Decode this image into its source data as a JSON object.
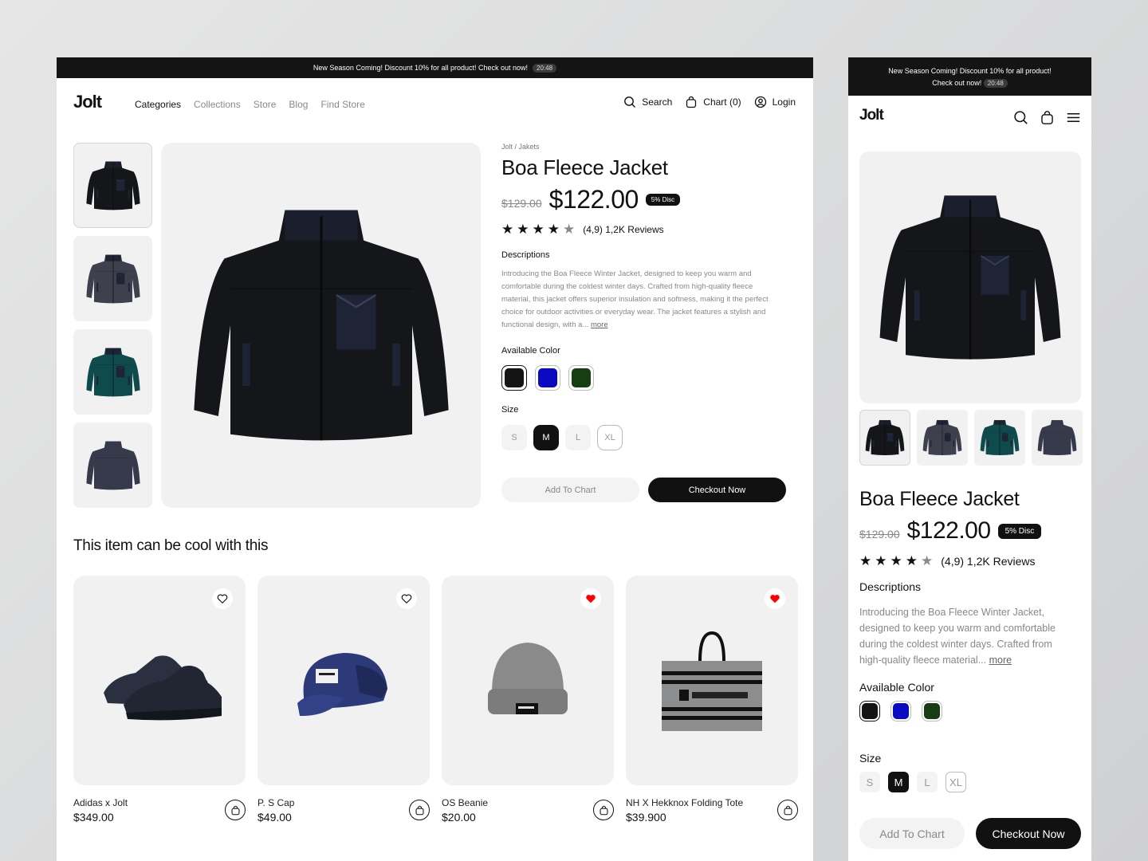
{
  "promo": {
    "text": "New Season Coming! Discount 10% for all product! Check out now!",
    "text_line1": "New Season Coming! Discount 10% for all product!",
    "text_line2": "Check out now!",
    "timer": "20:48"
  },
  "brand": {
    "logo": "Jolt"
  },
  "nav": {
    "menu": [
      {
        "label": "Categories",
        "active": true
      },
      {
        "label": "Collections",
        "active": false
      },
      {
        "label": "Store",
        "active": false
      },
      {
        "label": "Blog",
        "active": false
      },
      {
        "label": "Find Store",
        "active": false
      }
    ],
    "search_label": "Search",
    "cart_label": "Chart (0)",
    "login_label": "Login"
  },
  "product": {
    "breadcrumb": "Jolt / Jakets",
    "title": "Boa Fleece Jacket",
    "old_price": "$129.00",
    "price": "$122.00",
    "discount_badge": "5% Disc",
    "rating": {
      "stars_filled": 4,
      "stars_total": 5,
      "text": "(4,9) 1,2K Reviews"
    },
    "descriptions_label": "Descriptions",
    "description": "Introducing the Boa Fleece Winter Jacket, designed to keep you warm and comfortable during the coldest winter days. Crafted from high-quality fleece material, this jacket offers superior insulation and softness, making it the perfect choice for outdoor activities or everyday wear. The jacket features a stylish and functional design, with a...",
    "description_mobile": "Introducing the Boa Fleece Winter Jacket, designed to keep you warm and comfortable during the coldest winter days. Crafted from high-quality fleece material...",
    "more_link": "more",
    "color_label": "Available Color",
    "colors": [
      {
        "name": "black",
        "hex": "#141414",
        "selected": true
      },
      {
        "name": "blue",
        "hex": "#0a0ac0",
        "selected": false
      },
      {
        "name": "green",
        "hex": "#173d13",
        "selected": false
      }
    ],
    "size_label": "Size",
    "sizes": [
      {
        "label": "S",
        "state": "default"
      },
      {
        "label": "M",
        "state": "selected"
      },
      {
        "label": "L",
        "state": "default"
      },
      {
        "label": "XL",
        "state": "outline"
      }
    ],
    "gallery": [
      {
        "variant": "black-front",
        "color": "#15161a"
      },
      {
        "variant": "charcoal-front",
        "color": "#3e414d"
      },
      {
        "variant": "teal-front",
        "color": "#0f4a4d"
      },
      {
        "variant": "navy-back",
        "color": "#363a4b"
      }
    ],
    "add_to_cart": "Add To Chart",
    "checkout": "Checkout Now"
  },
  "recommendations": {
    "title": "This item can be cool with this",
    "items": [
      {
        "name": "Adidas x Jolt",
        "price": "$349.00",
        "favorited": false,
        "image": "sneakers"
      },
      {
        "name": "P. S Cap",
        "price": "$49.00",
        "favorited": false,
        "image": "cap"
      },
      {
        "name": "OS Beanie",
        "price": "$20.00",
        "favorited": true,
        "image": "beanie"
      },
      {
        "name": "NH X Hekknox Folding Tote",
        "price": "$39.900",
        "favorited": true,
        "image": "tote"
      }
    ]
  },
  "colors": {
    "accent": "#111111",
    "favorite": "#ff0000",
    "muted_text": "#888888"
  }
}
